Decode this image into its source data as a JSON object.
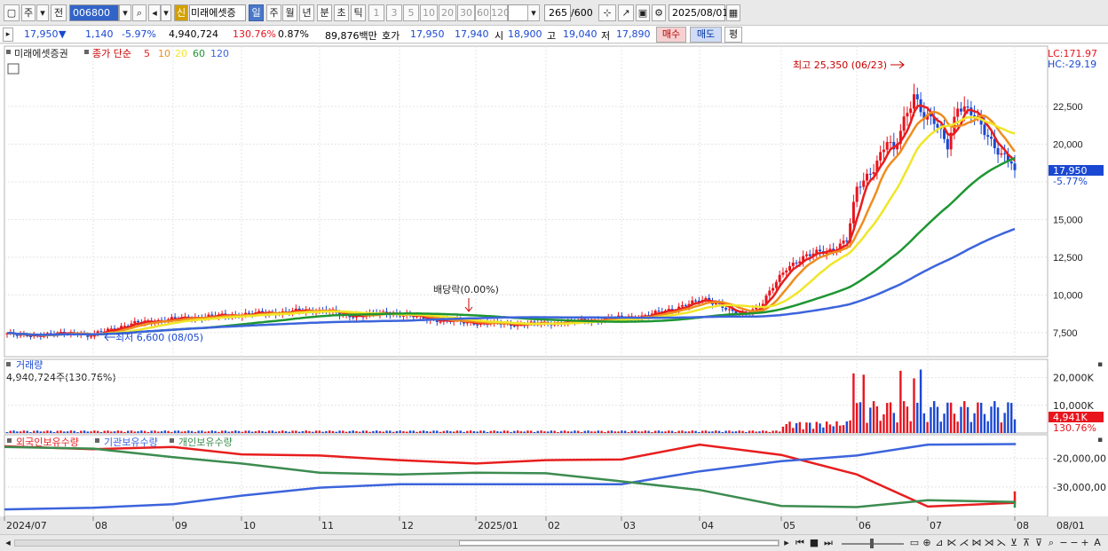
{
  "toolbar": {
    "market_type": "주",
    "prev_label": "전",
    "code": "006800",
    "credit_badge": "신",
    "stock_name": "미래에셋증",
    "periods": [
      "일",
      "주",
      "월",
      "년",
      "분",
      "초",
      "틱"
    ],
    "active_period": "일",
    "intervals": [
      "1",
      "3",
      "5",
      "10",
      "20",
      "30",
      "60",
      "120"
    ],
    "count_current": "265",
    "count_max": "/600",
    "date": "2025/08/01"
  },
  "quote": {
    "price": "17,950",
    "arrow": "▼",
    "change": "1,140",
    "change_pct": "-5.97%",
    "volume": "4,940,724",
    "volume_ratio": "130.76%",
    "turnover": "0.87%",
    "amount": "89,876백만",
    "bid_label": "호가",
    "bid": "17,950",
    "ask": "17,940",
    "open_label": "시",
    "open": "18,900",
    "high_label": "고",
    "high": "19,040",
    "low_label": "저",
    "low": "17,890",
    "buy_label": "매수",
    "sell_label": "매도",
    "eval_label": "평"
  },
  "legend": {
    "name": "미래에셋증권",
    "ma_prefix": "종가 단순",
    "ma_periods": [
      "5",
      "10",
      "20",
      "60",
      "120"
    ],
    "lc": "LC:171.97",
    "hc": "HC:-29.19",
    "volume_title": "거래량",
    "volume_value": "4,940,724주(130.76%)",
    "holding_series": [
      "외국인보유수량",
      "기관보유수량",
      "개인보유수량"
    ]
  },
  "annotations": {
    "high": "최고 25,350 (06/23)",
    "low": "최저 6,600 (08/05)",
    "dividend": "배당락(0.00%)",
    "last_price": "17,950",
    "last_change": "-5.77%",
    "last_volume": "4,941K",
    "last_volume_ratio": "130.76%"
  },
  "colors": {
    "up": "#e8141e",
    "down": "#1a48d2",
    "ma5": "#e81e1e",
    "ma10": "#f08c1e",
    "ma20": "#f0e628",
    "ma60": "#1e9632",
    "ma120": "#3c64dc",
    "foreign": "#e81e1e",
    "institution": "#3c64dc",
    "individual": "#3c8c50",
    "price_tag": "#1a48d2",
    "volume_tag": "#e8141e"
  },
  "chart_data": [
    {
      "type": "candlestick",
      "title": "미래에셋증권",
      "x": [
        "2024/07",
        "08",
        "09",
        "10",
        "11",
        "12",
        "2025/01",
        "02",
        "03",
        "04",
        "05",
        "06",
        "07",
        "08",
        "08/01"
      ],
      "y_ticks": [
        "7,500",
        "10,000",
        "12,500",
        "15,000",
        "17,500",
        "20,000",
        "22,500"
      ],
      "ylim": [
        5900,
        26500
      ],
      "close_monthly": [
        {
          "date": "2024/07",
          "close": 7500
        },
        {
          "date": "2024/08",
          "close": 7400
        },
        {
          "date": "2024/09",
          "close": 8300
        },
        {
          "date": "2024/10",
          "close": 8600
        },
        {
          "date": "2024/11",
          "close": 8800
        },
        {
          "date": "2024/12",
          "close": 8400
        },
        {
          "date": "2025/01",
          "close": 8100
        },
        {
          "date": "2025/02",
          "close": 8300
        },
        {
          "date": "2025/03",
          "close": 9500
        },
        {
          "date": "2025/04",
          "close": 8900
        },
        {
          "date": "2025/05",
          "close": 12400
        },
        {
          "date": "2025/06",
          "close": 21000
        },
        {
          "date": "2025/07",
          "close": 20400
        },
        {
          "date": "2025/08/01",
          "close": 17950
        }
      ],
      "moving_averages": [
        "5",
        "10",
        "20",
        "60",
        "120"
      ],
      "high": {
        "value": 25350,
        "date": "06/23"
      },
      "low": {
        "value": 6600,
        "date": "08/05"
      },
      "last": {
        "open": 18900,
        "high": 19040,
        "low": 17890,
        "close": 17950
      }
    },
    {
      "type": "bar",
      "title": "거래량",
      "y_ticks": [
        "10,000K",
        "20,000K"
      ],
      "last_value": 4940724
    },
    {
      "type": "line",
      "y_ticks": [
        "-30,000,00",
        "-20,000,00"
      ],
      "series": [
        {
          "name": "외국인보유수량",
          "values": [
            -15800000,
            -16800000,
            -16000000,
            -18600000,
            -19000000,
            -20600000,
            -21800000,
            -20600000,
            -20400000,
            -15200000,
            -18800000,
            -25600000,
            -36800000,
            -35500000,
            -31500000
          ]
        },
        {
          "name": "기관보유수량",
          "values": [
            -37800000,
            -37200000,
            -36000000,
            -33000000,
            -30200000,
            -29000000,
            -29000000,
            -29000000,
            -29000000,
            -24500000,
            -21000000,
            -19000000,
            -15200000,
            -15000000,
            -15400000
          ]
        },
        {
          "name": "개인보유수량",
          "values": [
            -16000000,
            -16600000,
            -19600000,
            -21800000,
            -25000000,
            -25600000,
            -25000000,
            -25200000,
            -28000000,
            -31000000,
            -36600000,
            -37000000,
            -34600000,
            -35200000,
            -37200000
          ]
        }
      ]
    }
  ]
}
